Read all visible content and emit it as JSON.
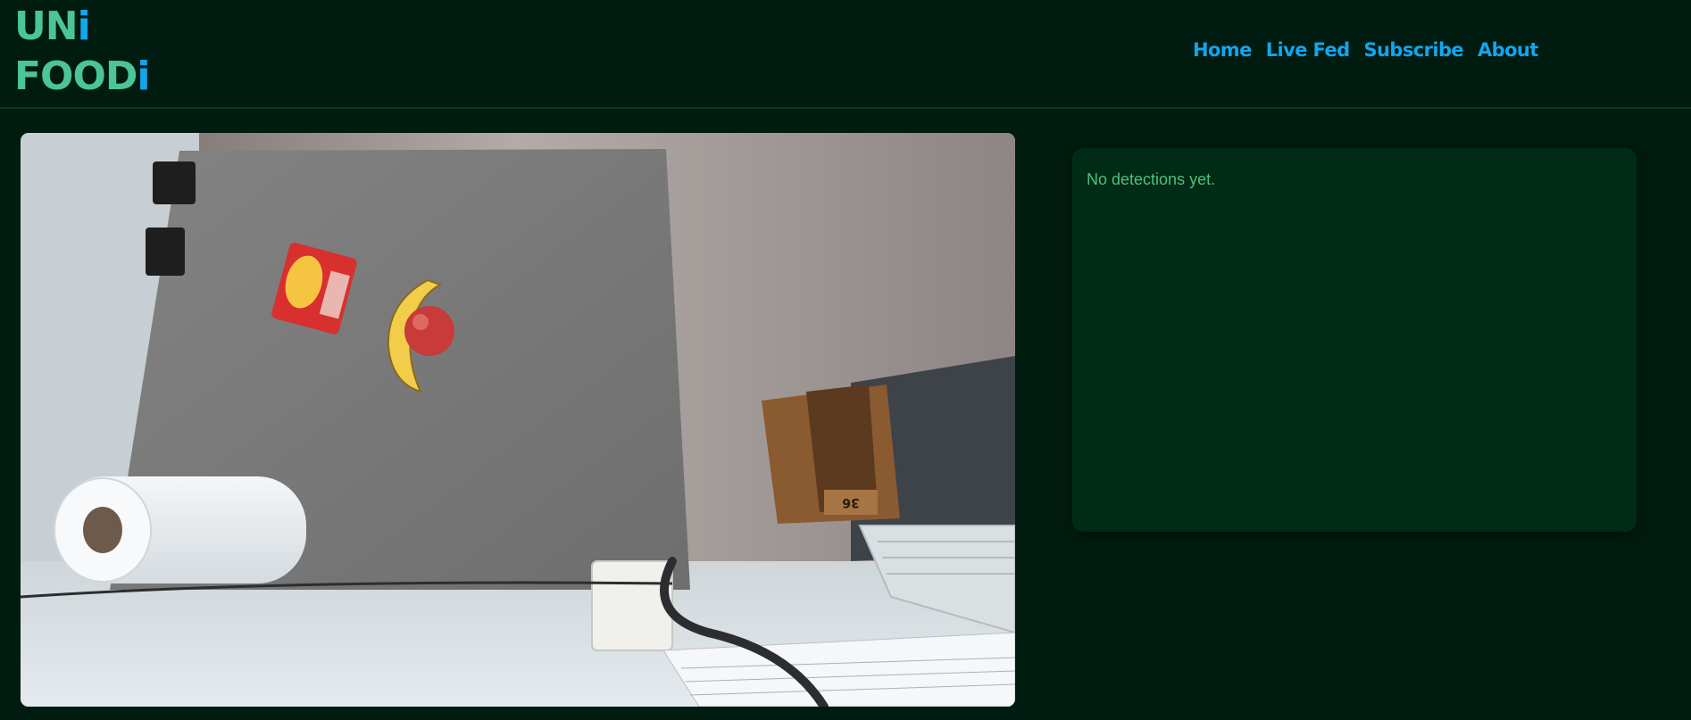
{
  "logo": {
    "line1_main": "UN",
    "line1_accent": "i",
    "line2_main": "FOOD",
    "line2_accent": "i"
  },
  "nav": {
    "items": [
      "Home",
      "Live Fed",
      "Subscribe",
      "About"
    ]
  },
  "feed": {
    "box_label": "36"
  },
  "detections": {
    "empty_text": "No detections yet."
  },
  "colors": {
    "background": "#001b10",
    "logo_main": "#4cc49a",
    "accent": "#13a6ee",
    "panel": "#002b16",
    "panel_text": "#4fbf7f"
  }
}
